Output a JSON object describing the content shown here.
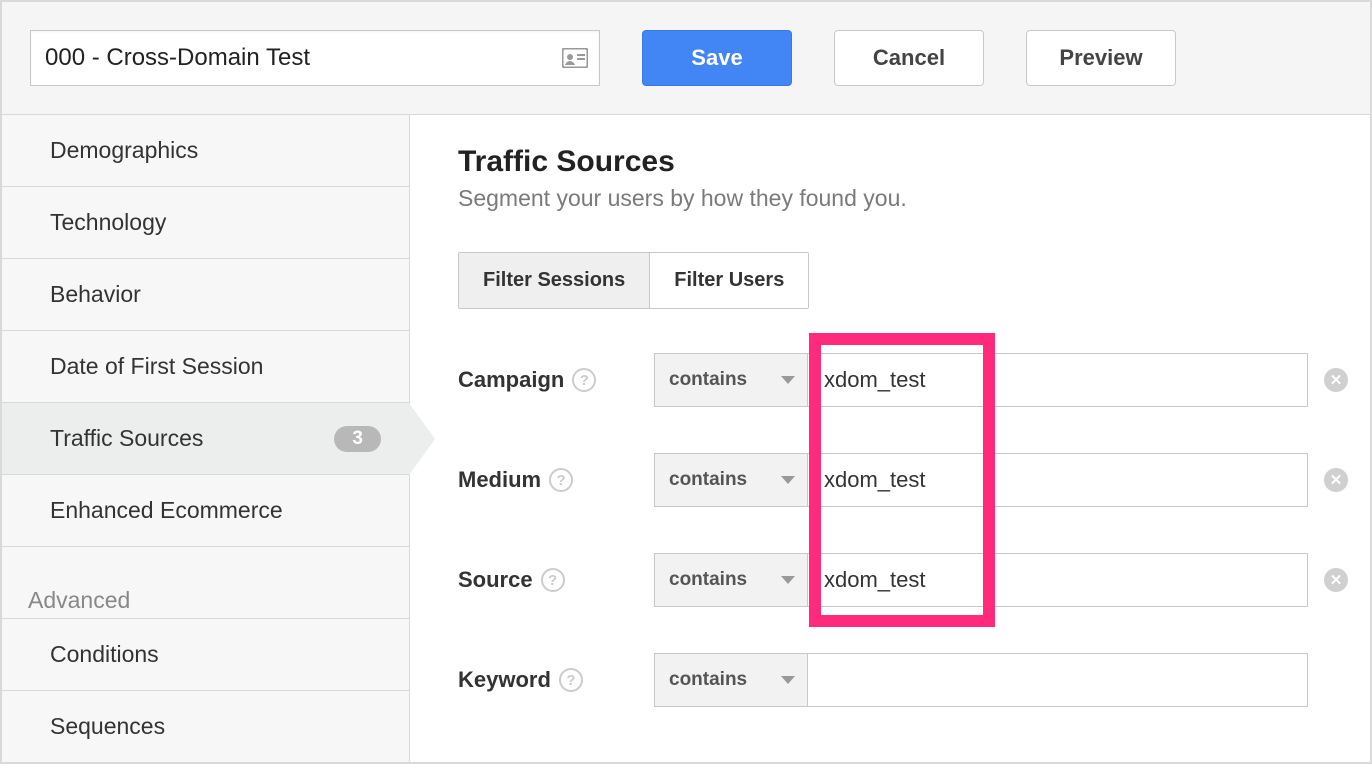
{
  "header": {
    "segment_name": "000 - Cross-Domain Test",
    "save_label": "Save",
    "cancel_label": "Cancel",
    "preview_label": "Preview"
  },
  "sidebar": {
    "items": [
      {
        "label": "Demographics"
      },
      {
        "label": "Technology"
      },
      {
        "label": "Behavior"
      },
      {
        "label": "Date of First Session"
      },
      {
        "label": "Traffic Sources",
        "badge": "3",
        "active": true
      },
      {
        "label": "Enhanced Ecommerce"
      }
    ],
    "advanced_label": "Advanced",
    "advanced_items": [
      {
        "label": "Conditions"
      },
      {
        "label": "Sequences"
      }
    ]
  },
  "main": {
    "title": "Traffic Sources",
    "subtitle": "Segment your users by how they found you.",
    "filter_sessions": "Filter Sessions",
    "filter_users": "Filter Users",
    "rows": [
      {
        "label": "Campaign",
        "op": "contains",
        "value": "xdom_test"
      },
      {
        "label": "Medium",
        "op": "contains",
        "value": "xdom_test"
      },
      {
        "label": "Source",
        "op": "contains",
        "value": "xdom_test"
      },
      {
        "label": "Keyword",
        "op": "contains",
        "value": ""
      }
    ]
  }
}
